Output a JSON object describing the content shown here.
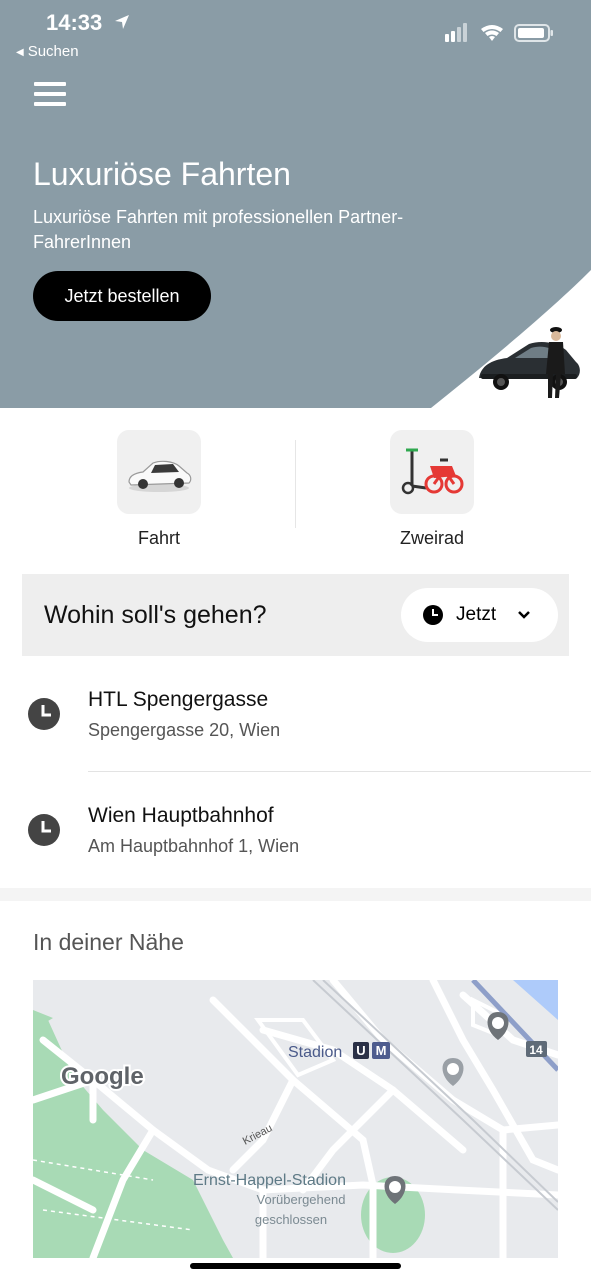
{
  "status_bar": {
    "time": "14:33",
    "back_label": "Suchen"
  },
  "hero": {
    "title": "Luxuriöse Fahrten",
    "subtitle": "Luxuriöse Fahrten mit professionellen Partner-FahrerInnen",
    "button_label": "Jetzt bestellen",
    "background_color": "#8a9ca6"
  },
  "services": [
    {
      "label": "Fahrt",
      "icon": "car-icon"
    },
    {
      "label": "Zweirad",
      "icon": "scooter-bike-icon"
    }
  ],
  "search": {
    "placeholder": "Wohin soll's gehen?",
    "time_label": "Jetzt"
  },
  "recent_places": [
    {
      "title": "HTL Spengergasse",
      "address": "Spengergasse 20, Wien"
    },
    {
      "title": "Wien Hauptbahnhof",
      "address": "Am Hauptbahnhof 1, Wien"
    }
  ],
  "nearby": {
    "title": "In deiner Nähe",
    "map": {
      "provider_logo": "Google",
      "labels": {
        "station": "Stadion",
        "street": "Krieau",
        "stadium": "Ernst-Happel-Stadion",
        "status_line1": "Vorübergehend",
        "status_line2": "geschlossen",
        "tram_line": "14",
        "u_badge": "U",
        "m_badge": "M"
      }
    }
  }
}
